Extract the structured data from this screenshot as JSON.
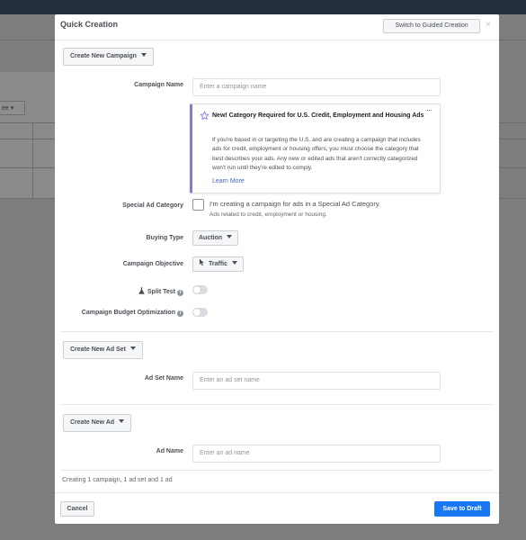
{
  "background": {
    "dropdown_text": "ee"
  },
  "modal": {
    "title": "Quick Creation",
    "switch_button": "Switch to Guided Creation",
    "close_symbol": "×"
  },
  "campaign": {
    "section_button": "Create New Campaign",
    "name_label": "Campaign Name",
    "name_placeholder": "Enter a campaign name",
    "notice": {
      "title": "New! Category Required for U.S. Credit, Employment and Housing Ads",
      "body": "If you're based in or targeting the U.S. and are creating a campaign that includes ads for credit, employment or housing offers, you must choose the category that best describes your ads. Any new or edited ads that aren't correctly categorized won't run until they're edited to comply.",
      "link": "Learn More",
      "more_symbol": "···"
    },
    "special_label": "Special Ad Category",
    "special_checkbox_text": "I'm creating a campaign for ads in a Special Ad Category.",
    "special_subtext": "Ads related to credit, employment or housing.",
    "buying_type_label": "Buying Type",
    "buying_type_value": "Auction",
    "objective_label": "Campaign Objective",
    "objective_value": "Traffic",
    "split_test_label": "Split Test",
    "split_test_on": false,
    "cbo_label": "Campaign Budget Optimization",
    "cbo_on": false,
    "info_symbol": "i"
  },
  "ad_set": {
    "section_button": "Create New Ad Set",
    "name_label": "Ad Set Name",
    "name_placeholder": "Enter an ad set name"
  },
  "ad": {
    "section_button": "Create New Ad",
    "name_label": "Ad Name",
    "name_placeholder": "Enter an ad name"
  },
  "footer": {
    "summary": "Creating 1 campaign, 1 ad set and 1 ad",
    "cancel": "Cancel",
    "save": "Save to Draft"
  },
  "colors": {
    "primary": "#1877f2",
    "notice_accent": "#8b7bd8",
    "link": "#4267b2"
  }
}
